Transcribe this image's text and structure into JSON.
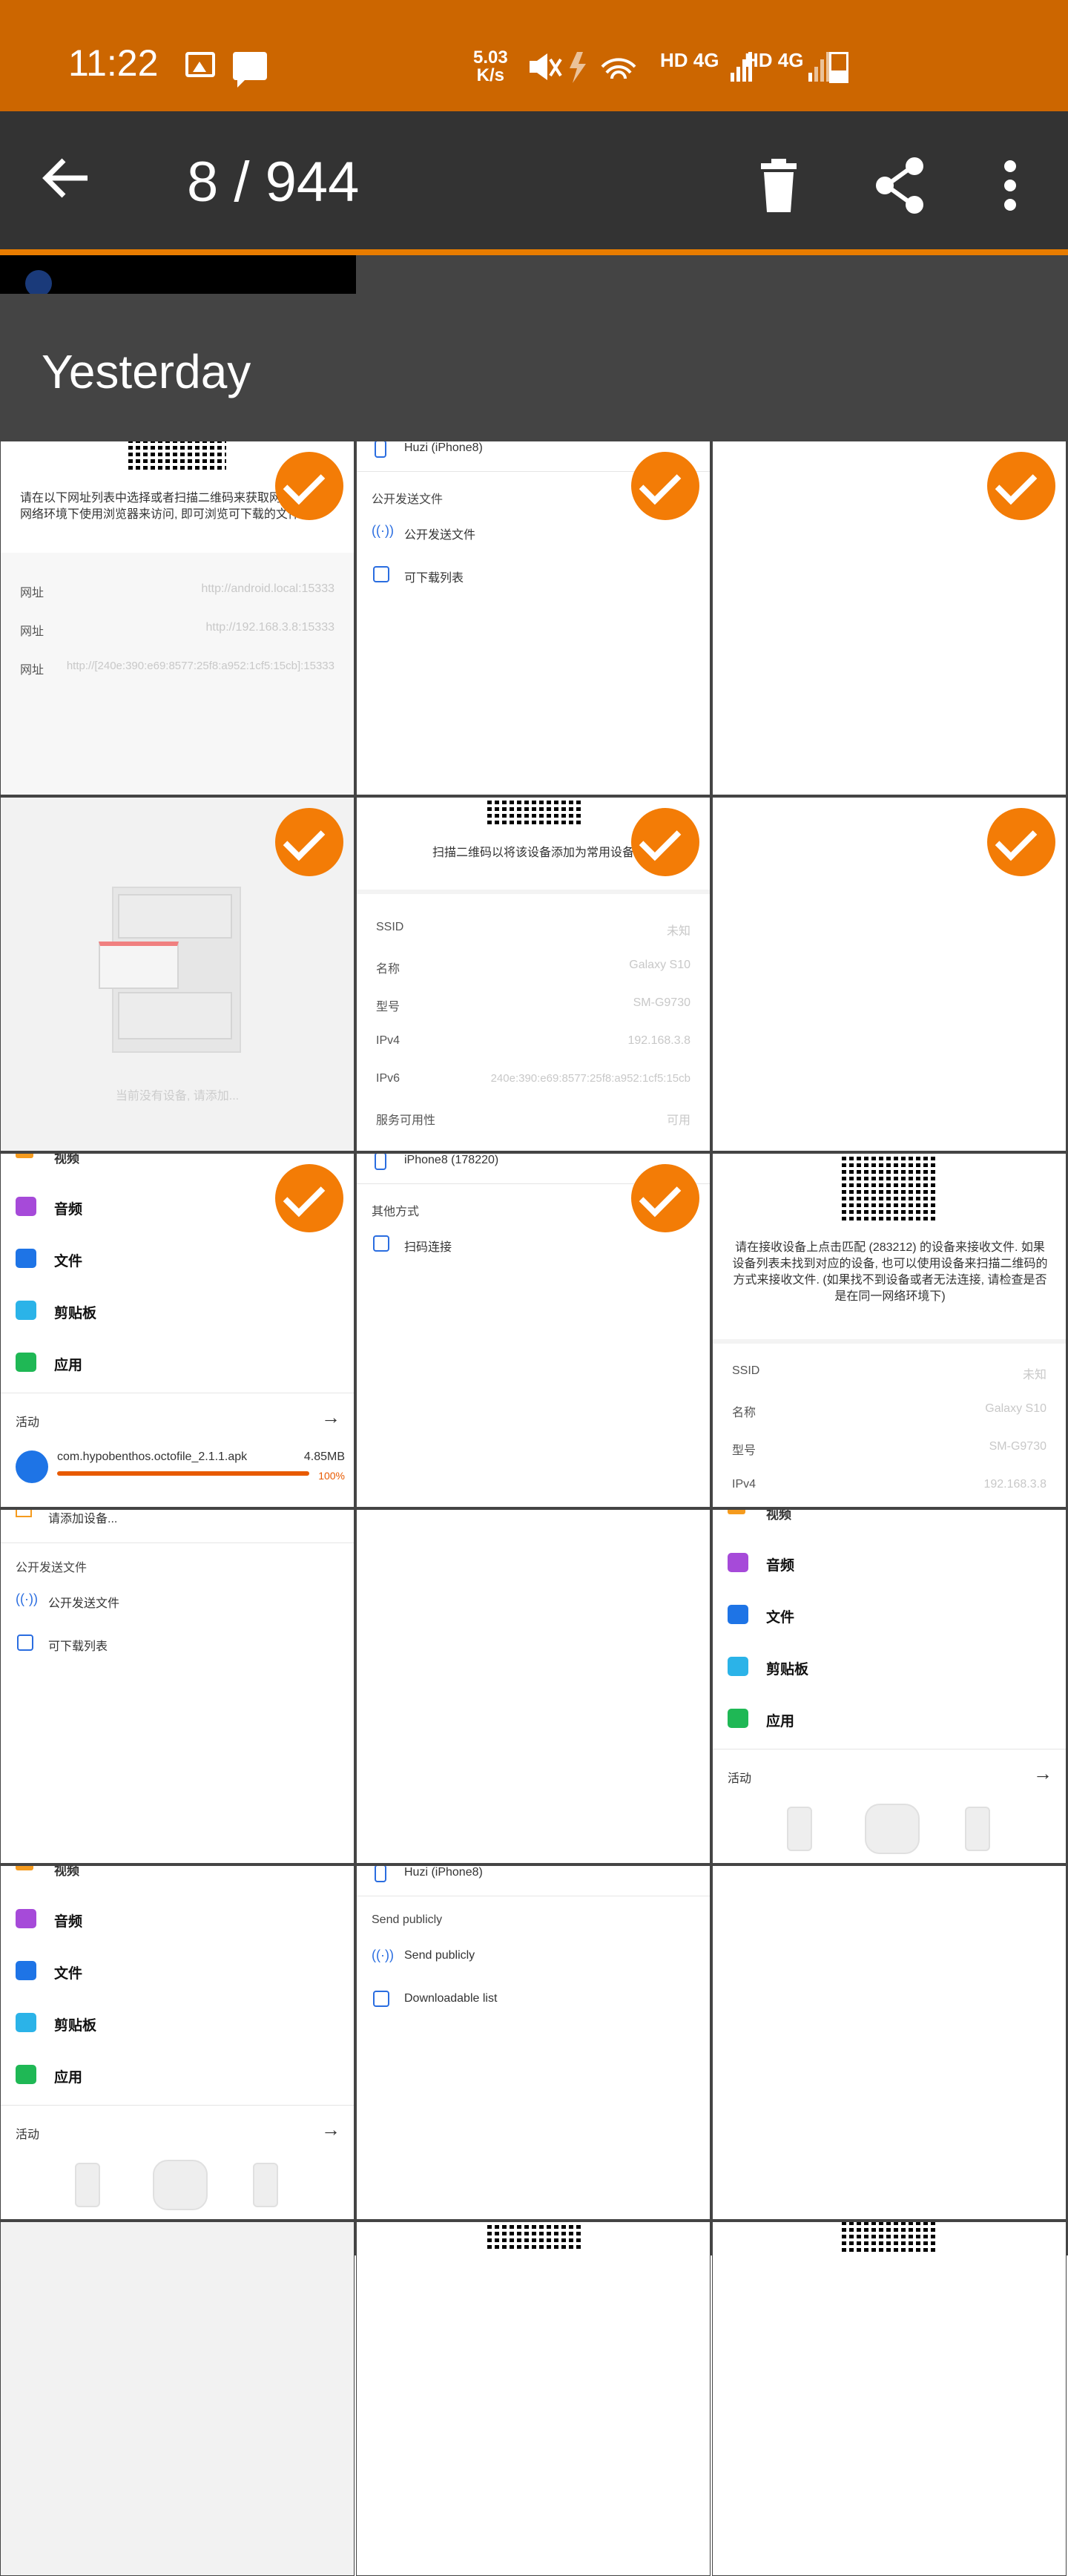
{
  "status_bar": {
    "time": "11:22",
    "speed_value": "5.03",
    "speed_unit": "K/s",
    "network_1": "HD 4G",
    "network_2": "HD 4G",
    "icons": [
      "image-icon",
      "message-icon",
      "mute-icon",
      "charging-icon",
      "wifi-icon",
      "signal-icon",
      "battery-icon"
    ]
  },
  "toolbar": {
    "counter": "8 / 944",
    "back_icon": "arrow-left-icon",
    "delete_icon": "trash-icon",
    "share_icon": "share-icon",
    "more_icon": "more-vert-icon"
  },
  "section": {
    "title": "Yesterday"
  },
  "colors": {
    "accent": "#f37c06",
    "statusbar": "#cc6600",
    "toolbar": "#333333",
    "section": "#444444"
  },
  "thumbnails": {
    "t1": {
      "description": "请在以下网址列表中选择或者扫描二维码来获取网址",
      "description2": "网络环境下使用浏览器来访问, 即可浏览可下载的文件",
      "rows": [
        {
          "label": "网址",
          "value": "http://android.local:15333"
        },
        {
          "label": "网址",
          "value": "http://192.168.3.8:15333"
        },
        {
          "label": "网址",
          "value": "http://[240e:390:e69:8577:25f8:a952:1cf5:15cb]:15333"
        }
      ]
    },
    "t2": {
      "device": "Huzi (iPhone8)",
      "section": "公开发送文件",
      "item1": "公开发送文件",
      "item2": "可下载列表"
    },
    "t4": {
      "empty_text": "当前没有设备, 请添加..."
    },
    "t5": {
      "caption": "扫描二维码以将该设备添加为常用设备",
      "rows": [
        {
          "label": "SSID",
          "value": "未知"
        },
        {
          "label": "名称",
          "value": "Galaxy S10"
        },
        {
          "label": "型号",
          "value": "SM-G9730"
        },
        {
          "label": "IPv4",
          "value": "192.168.3.8"
        },
        {
          "label": "IPv6",
          "value": "240e:390:e69:8577:25f8:a952:1cf5:15cb"
        },
        {
          "label": "服务可用性",
          "value": "可用"
        }
      ]
    },
    "t7": {
      "partial_top": "视频",
      "items": [
        "音频",
        "文件",
        "剪贴板",
        "应用"
      ],
      "activity": "活动",
      "file_name": "com.hypobenthos.octofile_2.1.1.apk",
      "file_size": "4.85MB",
      "file_progress": "100%",
      "file_progress_value": 100
    },
    "t8": {
      "device": "iPhone8 (178220)",
      "section": "其他方式",
      "item": "扫码连接"
    },
    "t9": {
      "text": "请在接收设备上点击匹配 (283212) 的设备来接收文件. 如果设备列表未找到对应的设备, 也可以使用设备来扫描二维码的方式来接收文件. (如果找不到设备或者无法连接, 请检查是否是在同一网络环境下)",
      "rows": [
        {
          "label": "SSID",
          "value": "未知"
        },
        {
          "label": "名称",
          "value": "Galaxy S10"
        },
        {
          "label": "型号",
          "value": "SM-G9730"
        },
        {
          "label": "IPv4",
          "value": "192.168.3.8"
        }
      ]
    },
    "t10": {
      "top_item": "请添加设备...",
      "section": "公开发送文件",
      "item1": "公开发送文件",
      "item2": "可下载列表"
    },
    "t12": {
      "partial_top": "视频",
      "items": [
        "音频",
        "文件",
        "剪贴板",
        "应用"
      ],
      "activity": "活动"
    },
    "t13": {
      "partial_top": "视频",
      "items": [
        "音频",
        "文件",
        "剪贴板",
        "应用"
      ],
      "activity": "活动"
    },
    "t14": {
      "device": "Huzi (iPhone8)",
      "section": "Send publicly",
      "item1": "Send publicly",
      "item2": "Downloadable list"
    }
  }
}
